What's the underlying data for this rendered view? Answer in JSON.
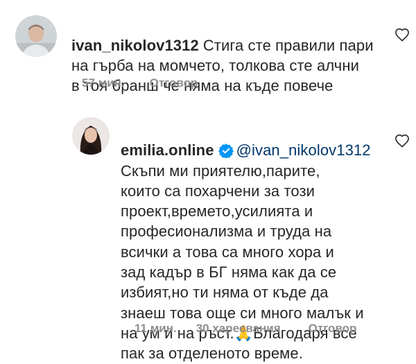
{
  "comment1": {
    "username": "ivan_nikolov1312",
    "text": "Стига сте правили пари\nна гърба на момчето, толкова сте алчни\nв тоя бранш че няма на къде повече",
    "line1_rest": "Стига сте правили пари",
    "line2": "на гърба на момчето, толкова сте алчни",
    "line3": "в тоя бранш че няма на къде повече",
    "time": "57 мин.",
    "reply_label": "Отговор",
    "avatar_icon": "user-avatar-photo",
    "like_icon": "heart-outline-icon"
  },
  "comment2": {
    "username": "emilia.online",
    "verified_icon": "verified-badge-icon",
    "mention": "@ivan_nikolov1312",
    "lines": [
      "Скъпи ми приятелю,парите,",
      "които са похарчени за този",
      "проект,времето,усилията и",
      "професионализма и труда на",
      "всички а това са много хора и",
      "зад кадър в БГ няма как да се",
      "избият,но ти няма от къде да",
      "знаеш това още си много малък и",
      "на ум и на ръст.🙏Благодаря все",
      "пак за отделеното време."
    ],
    "time": "11 мин.",
    "likes": "30 харесвания",
    "reply_label": "Отговор",
    "avatar_icon": "user-avatar-photo",
    "like_icon": "heart-outline-icon"
  },
  "colors": {
    "text": "#262626",
    "secondary": "#8e8e8e",
    "mention": "#00376b",
    "verified": "#0095f6"
  }
}
